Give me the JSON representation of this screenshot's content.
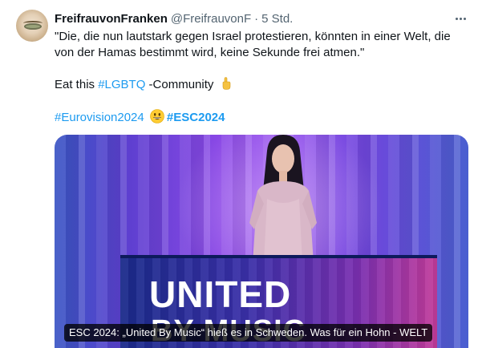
{
  "tweet": {
    "author_name": "FreifrauvonFranken",
    "handle": "@FreifrauvonF",
    "separator": "·",
    "time": "5 Std.",
    "lines": [
      "\"Die, die nun lautstark gegen Israel protestieren, könnten in einer Welt, die",
      "von der Hamas bestimmt wird, keine Sekunde frei atmen.\""
    ],
    "eat_prefix": "Eat this ",
    "hashtag_lgbtq": "#LGBTQ",
    "eat_suffix": " -Community",
    "hashtag_eurovision": "#Eurovision2024",
    "hashtag_esc": "#ESC2024"
  },
  "icons": {
    "more": "more-horizontal-icon",
    "hand": "pointing-up-hand-icon",
    "smiley": "grinning-face-icon"
  },
  "media": {
    "podium_line1": "UNITED",
    "podium_line2": "BY MUSIC",
    "caption": "ESC 2024: „United By Music“ hieß es in Schweden. Was für ein Hohn - WELT"
  },
  "colors": {
    "link": "#1d9bf0",
    "text": "#0f1419",
    "secondary": "#536471"
  }
}
